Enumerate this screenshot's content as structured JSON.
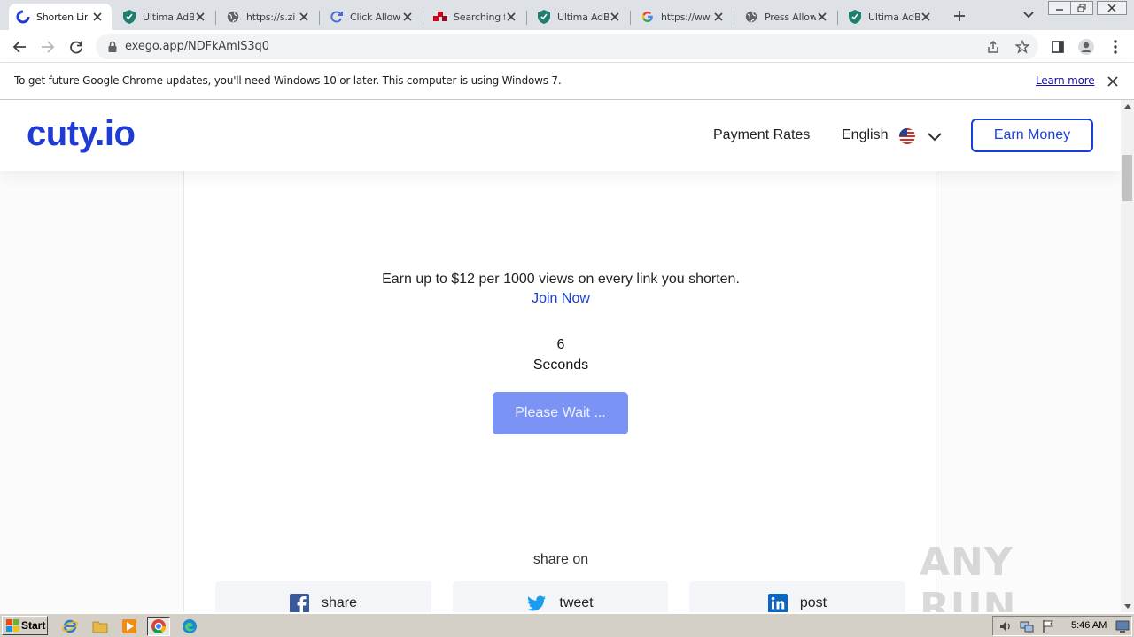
{
  "browser": {
    "tabs": [
      {
        "title": "Shorten Lin",
        "icon": "cuty-icon",
        "active": true
      },
      {
        "title": "Ultima AdBl",
        "icon": "shield-icon",
        "active": false
      },
      {
        "title": "https://s.zi",
        "icon": "globe-icon",
        "active": false
      },
      {
        "title": "Click Allow",
        "icon": "refresh-icon",
        "active": false
      },
      {
        "title": "Searching f",
        "icon": "dots-icon",
        "active": false
      },
      {
        "title": "Ultima AdBl",
        "icon": "shield-icon",
        "active": false
      },
      {
        "title": "https://ww",
        "icon": "google-icon",
        "active": false
      },
      {
        "title": "Press Allow",
        "icon": "globe-icon",
        "active": false
      },
      {
        "title": "Ultima AdBl",
        "icon": "shield-icon",
        "active": false
      }
    ],
    "url": "exego.app/NDFkAmlS3q0"
  },
  "infobar": {
    "message": "To get future Google Chrome updates, you'll need Windows 10 or later. This computer is using Windows 7.",
    "learn_more": "Learn more"
  },
  "site": {
    "logo": "cuty.io",
    "nav": {
      "payment_rates": "Payment Rates",
      "language": "English",
      "earn_money": "Earn Money"
    },
    "brand_color": "#1a3fd6",
    "promo": "Earn up to $12 per 1000 views on every link you shorten.",
    "join_now": "Join Now",
    "countdown": {
      "value": "6",
      "unit": "Seconds"
    },
    "wait_button": "Please Wait ...",
    "share": {
      "heading": "share on",
      "buttons": [
        {
          "label": "share",
          "icon": "facebook-icon"
        },
        {
          "label": "tweet",
          "icon": "twitter-icon"
        },
        {
          "label": "post",
          "icon": "linkedin-icon"
        }
      ]
    }
  },
  "watermark": "ANY RUN",
  "taskbar": {
    "start": "Start",
    "clock": "5:46 AM"
  }
}
